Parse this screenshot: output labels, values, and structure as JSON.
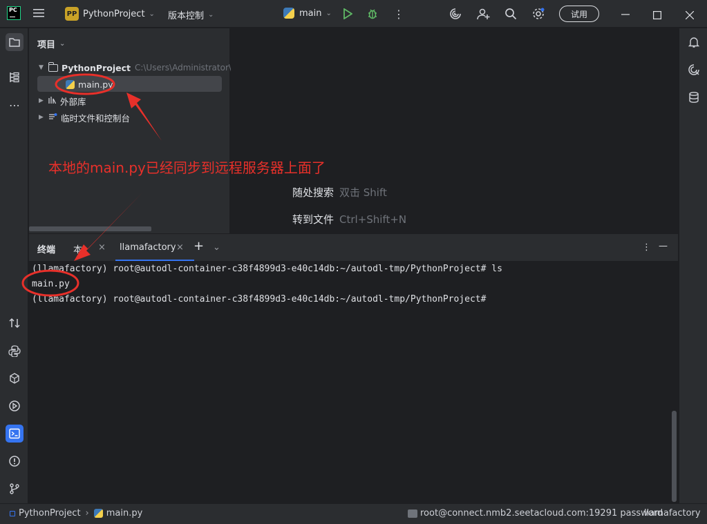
{
  "titlebar": {
    "logo": "PC",
    "project_badge": "PP",
    "project_name": "PythonProject",
    "vcs_label": "版本控制",
    "run_config": "main",
    "trial_label": "试用"
  },
  "project_panel": {
    "title": "项目",
    "tree": {
      "root_name": "PythonProject",
      "root_path": "C:\\Users\\Administrator\\P",
      "file_name": "main.py",
      "external_libs": "外部库",
      "scratches": "临时文件和控制台"
    }
  },
  "editor_hints": {
    "search_label": "随处搜索",
    "search_key": "双击 Shift",
    "goto_label": "转到文件",
    "goto_key": "Ctrl+Shift+N"
  },
  "terminal": {
    "tabs": [
      "终端",
      "本",
      "llamafactory"
    ],
    "lines": [
      "(llamafactory) root@autodl-container-c38f4899d3-e40c14db:~/autodl-tmp/PythonProject# ls",
      "main.py",
      "(llamafactory) root@autodl-container-c38f4899d3-e40c14db:~/autodl-tmp/PythonProject#"
    ]
  },
  "statusbar": {
    "breadcrumb_project": "PythonProject",
    "breadcrumb_file": "main.py",
    "connection": "root@connect.nmb2.seetacloud.com:19291 password",
    "interpreter": "llamafactory"
  },
  "annotation": {
    "text": "本地的main.py已经同步到远程服务器上面了",
    "color": "#e8302a"
  },
  "colors": {
    "accent": "#3574f0",
    "run_green": "#5fb865",
    "background": "#1e1f22",
    "panel": "#2b2d30"
  }
}
